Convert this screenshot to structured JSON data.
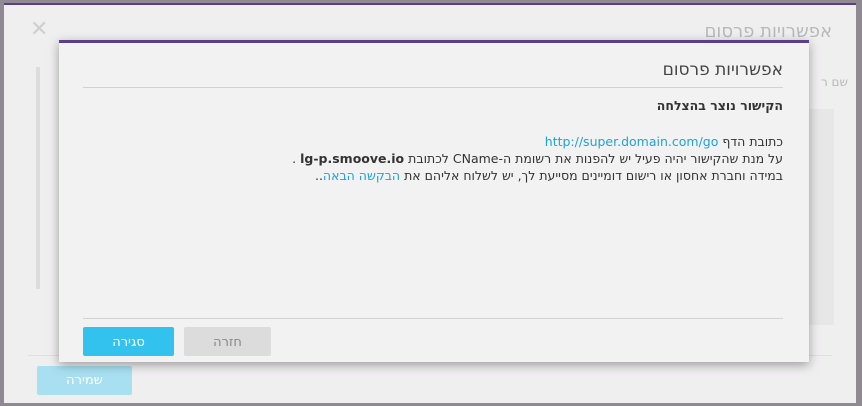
{
  "background": {
    "title": "אפשרויות פרסום",
    "close_glyph": "✕",
    "field_label": "שם ר",
    "save_label": "שמירה"
  },
  "modal": {
    "title": "אפשרויות פרסום",
    "success_heading": "הקישור נוצר בהצלחה",
    "page_address_label": "כתובת הדף",
    "page_url": "http://super.domain.com/go",
    "cname_text_before": "על מנת שהקישור יהיה פעיל יש להפנות את רשומת ה-CName לכתובת",
    "cname_target": "lg-p.smoove.io",
    "cname_text_after": ".",
    "hosting_text": "במידה וחברת אחסון או רישום דומיינים מסייעת לך, יש לשלוח אליהם את",
    "next_request_link": "הבקשה הבאה",
    "hosting_text_end": "..",
    "close_label": "סגירה",
    "back_label": "חזרה"
  },
  "colors": {
    "accent": "#5b3f8a",
    "primary_button": "#33c2ee",
    "link": "#1fa3d6"
  }
}
